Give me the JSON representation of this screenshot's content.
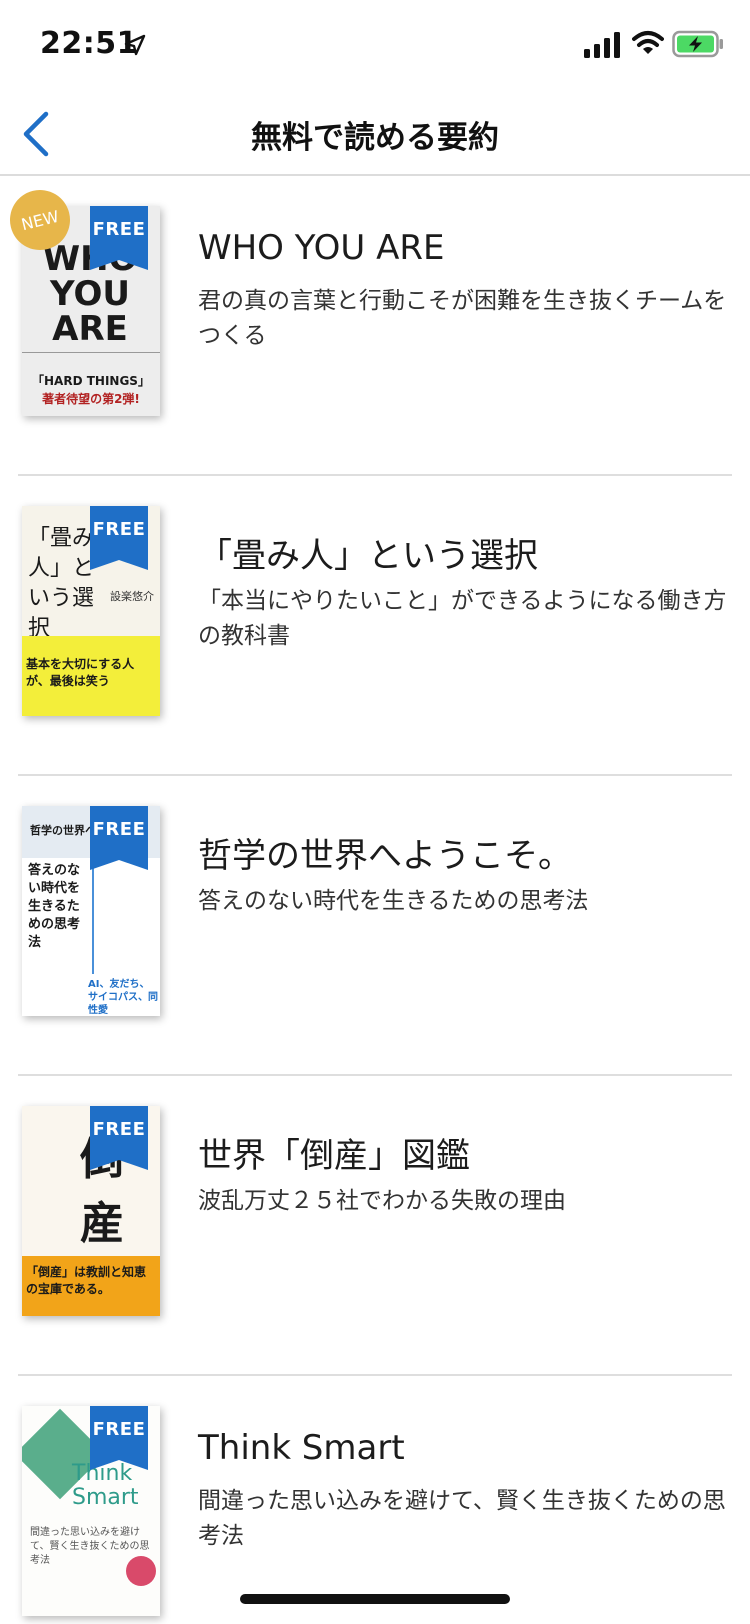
{
  "status_bar": {
    "time": "22:51",
    "icons": [
      "location-arrow-icon",
      "signal-bars-icon",
      "wifi-icon",
      "battery-charging-icon"
    ]
  },
  "nav": {
    "title": "無料で読める要約",
    "back_icon": "chevron-left-icon",
    "accent_color": "#1f6fc7"
  },
  "badges": {
    "free": "FREE",
    "new": "NEW",
    "free_color": "#1f6fc7",
    "new_color": "#e7b64a"
  },
  "items": [
    {
      "title": "WHO YOU ARE",
      "subtitle": "君の真の言葉と行動こそが困難を生き抜くチームをつくる",
      "is_new": true,
      "cover": {
        "main": "WHO YOU ARE",
        "banner": "「HARD THINGS」",
        "tagline": "著者待望の第2弾!"
      }
    },
    {
      "title": "「畳み人」という選択",
      "subtitle": "「本当にやりたいこと」ができるようになる働き方の教科書",
      "is_new": false,
      "cover": {
        "main": "「畳み人」という選択",
        "author": "設楽悠介",
        "tagline": "基本を大切にする人が、最後は笑う"
      }
    },
    {
      "title": "哲学の世界へようこそ。",
      "subtitle": "答えのない時代を生きるための思考法",
      "is_new": false,
      "cover": {
        "top": "哲学の世界へ",
        "main": "答えのない時代を生きるための思考法",
        "bottom": "AI、友だち、サイコパス、同性愛"
      }
    },
    {
      "title": "世界「倒産」図鑑",
      "subtitle": "波乱万丈２５社でわかる失敗の理由",
      "is_new": false,
      "cover": {
        "main": "倒産",
        "tagline": "「倒産」は教訓と知恵の宝庫である。"
      }
    },
    {
      "title": "Think Smart",
      "subtitle": "間違った思い込みを避けて、賢く生き抜くための思考法",
      "is_new": false,
      "cover": {
        "main": "Think Smart",
        "tagline": "間違った思い込みを避けて、賢く生き抜くための思考法"
      }
    }
  ]
}
